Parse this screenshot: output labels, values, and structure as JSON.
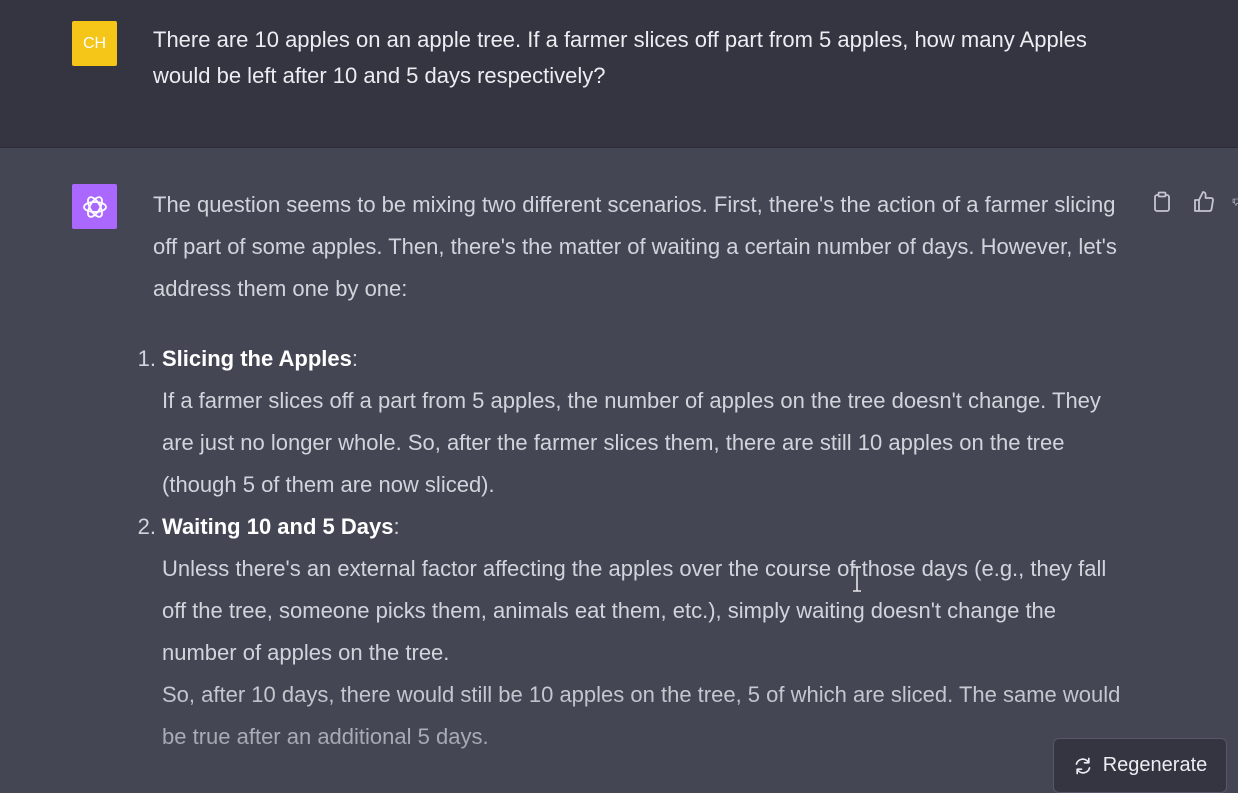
{
  "user_message": {
    "avatar_initials": "CH",
    "avatar_color": "#f5c518",
    "text": "There are 10 apples on an apple tree. If a farmer slices off part from 5 apples, how many Apples would be left after 10 and 5 days respectively?"
  },
  "assistant_message": {
    "avatar_icon": "openai-logo-icon",
    "avatar_color": "#ab68ff",
    "intro": "The question seems to be mixing two different scenarios. First, there's the action of a farmer slicing off part of some apples. Then, there's the matter of waiting a certain number of days. However, let's address them one by one:",
    "items": [
      {
        "number": "1.",
        "title": "Slicing the Apples",
        "body": "If a farmer slices off a part from 5 apples, the number of apples on the tree doesn't change. They are just no longer whole. So, after the farmer slices them, there are still 10 apples on the tree (though 5 of them are now sliced).",
        "extra": ""
      },
      {
        "number": "2.",
        "title": "Waiting 10 and 5 Days",
        "body": "Unless there's an external factor affecting the apples over the course of those days (e.g., they fall off the tree, someone picks them, animals eat them, etc.), simply waiting doesn't change the number of apples on the tree.",
        "extra": "So, after 10 days, there would still be 10 apples on the tree, 5 of which are sliced. The same would be true after an additional 5 days."
      }
    ],
    "actions": [
      "clipboard-icon",
      "thumbs-up-icon",
      "thumbs-down-icon"
    ]
  },
  "regenerate": {
    "label": "Regenerate",
    "icon": "refresh-icon"
  },
  "colors": {
    "user_bg": "#343541",
    "assistant_bg": "#444654"
  }
}
